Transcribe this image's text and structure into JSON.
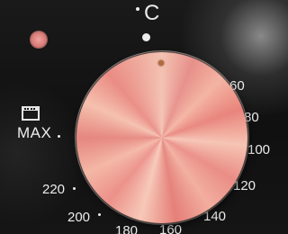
{
  "top_unit": "C",
  "max_label": "MAX",
  "temperature_labels": {
    "t60": "60",
    "t80": "80",
    "t100": "100",
    "t120": "120",
    "t140": "140",
    "t160": "160",
    "t180": "180",
    "t200": "200",
    "t220": "220"
  },
  "knob": {
    "finish": "rose-copper brushed metal",
    "color": "#f0a89a"
  },
  "icons": [
    "fan-oven-icon",
    "pointer-dot-icon"
  ]
}
